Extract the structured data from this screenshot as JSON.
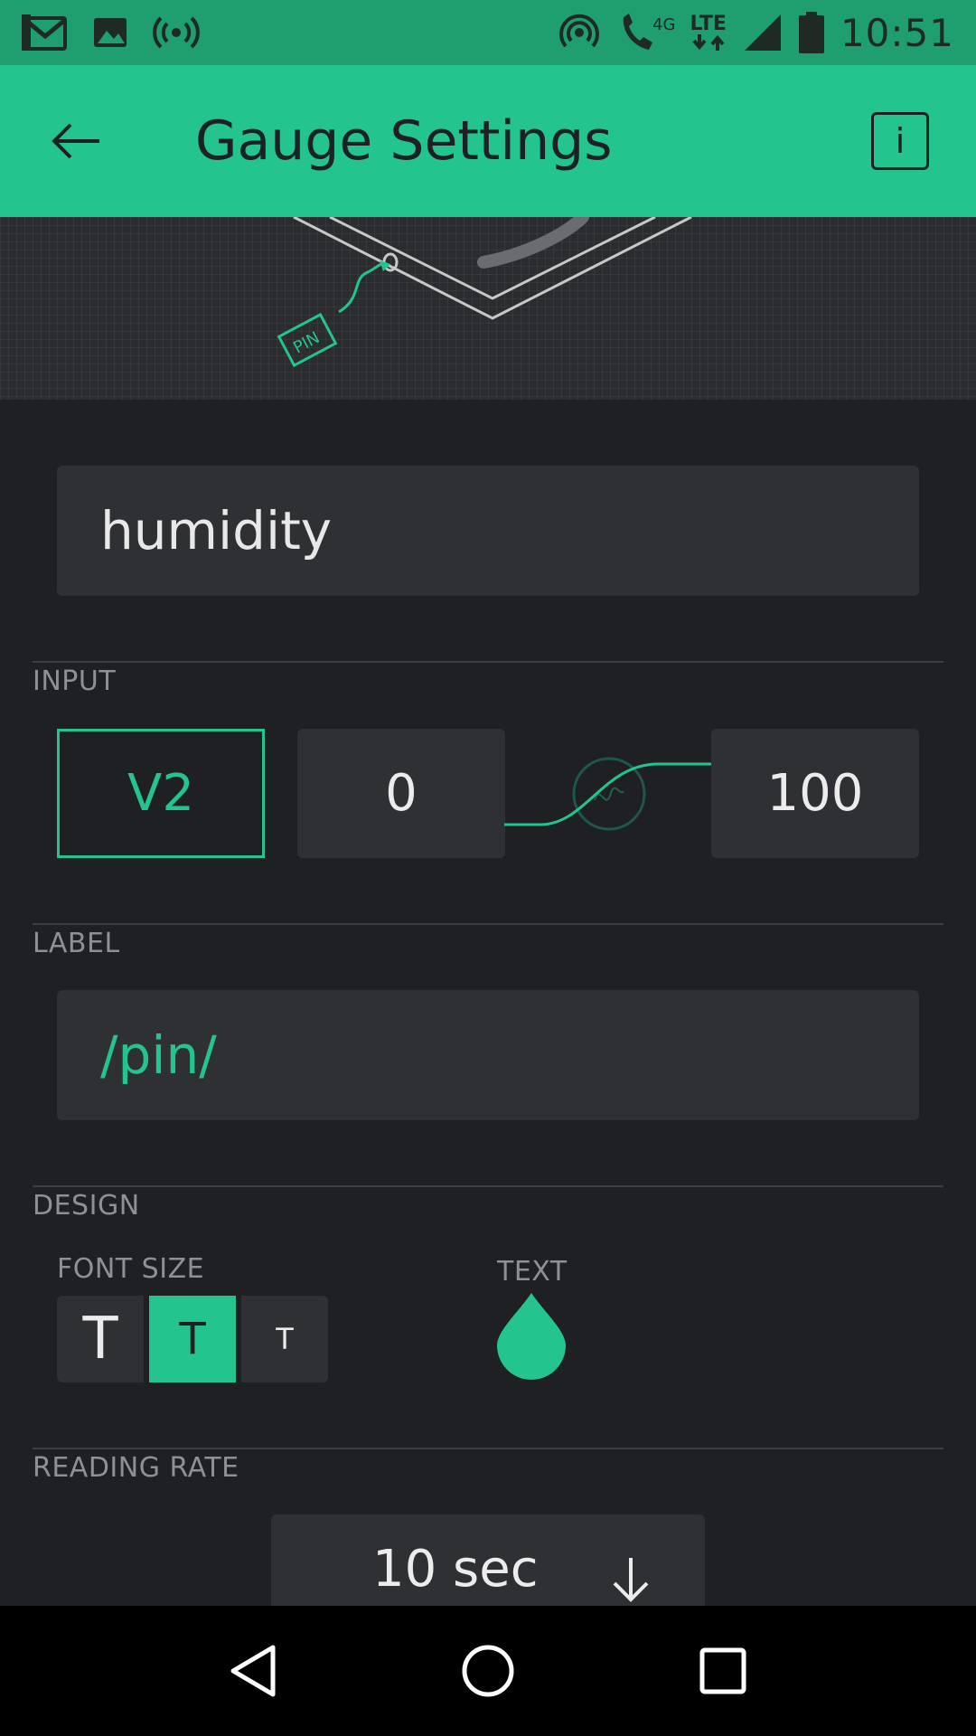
{
  "status_bar": {
    "time": "10:51",
    "network": "4G",
    "lte": "LTE",
    "icons": [
      "gmail-icon",
      "image-icon",
      "broadcast-icon",
      "hotspot-icon",
      "wifi-calling-icon",
      "signal-icon",
      "battery-icon"
    ]
  },
  "app_bar": {
    "title": "Gauge Settings",
    "back_icon": "arrow-left-icon",
    "info_label": "i"
  },
  "hero": {
    "pin_tag": "PIN"
  },
  "name_field": {
    "value": "humidity"
  },
  "input_section": {
    "label": "INPUT",
    "pin": "V2",
    "min": "0",
    "max": "100"
  },
  "label_section": {
    "label": "LABEL",
    "value": "/pin/"
  },
  "design_section": {
    "label": "DESIGN",
    "font_size_label": "FONT SIZE",
    "font_sizes": [
      "T",
      "T",
      "T"
    ],
    "selected_font_index": 1,
    "text_color_label": "TEXT",
    "text_color": "#23c48e"
  },
  "reading_rate": {
    "label": "READING RATE",
    "value": "10 sec"
  },
  "colors": {
    "accent": "#23c48e",
    "background": "#1e2024",
    "status_bar": "#1f9e6f"
  }
}
